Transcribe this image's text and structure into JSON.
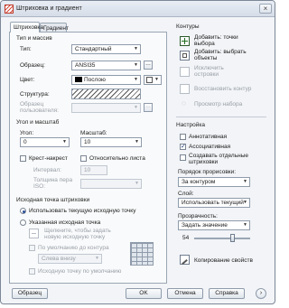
{
  "window": {
    "title": "Штриховка и градиент",
    "close_glyph": "×"
  },
  "tabs": [
    {
      "label": "Штриховка",
      "active": true
    },
    {
      "label": "Градиент",
      "active": false
    }
  ],
  "type_pattern": {
    "section": "Тип и массив",
    "type_label": "Тип:",
    "type_value": "Стандартный",
    "pattern_label": "Образец:",
    "pattern_value": "ANSI35",
    "color_label": "Цвет:",
    "color_value": "Послою",
    "structure_label": "Структура:",
    "user_pattern_label": "Образец пользователя:"
  },
  "angle_scale": {
    "section": "Угол и масштаб",
    "angle_label": "Угол:",
    "angle_value": "0",
    "scale_label": "Масштаб:",
    "scale_value": "10",
    "cross_label": "Крест-накрест",
    "relative_label": "Относительно листа",
    "interval_label": "Интервал:",
    "interval_value": "10",
    "pen_label": "Толщина пера ISO:"
  },
  "origin": {
    "section": "Исходная точка штриховки",
    "use_current_label": "Использовать текущую исходную точку",
    "specified_label": "Указанная исходная точка",
    "click_label": "Щелкните, чтобы задать новую исходную точку",
    "default_extents_label": "По умолчанию до контура",
    "extents_value": "Слева внизу",
    "store_label": "Исходную точку по умолчанию"
  },
  "contours": {
    "section": "Контуры",
    "add_pick_label": "Добавить: точки выбора",
    "add_select_label": "Добавить: выбрать объекты",
    "remove_label": "Исключить островки",
    "recreate_label": "Восстановить контур",
    "view_label": "Просмотр набора"
  },
  "options": {
    "section": "Настройка",
    "annotative_label": "Аннотативная",
    "associative_label": "Ассоциативная",
    "separate_label": "Создавать отдельные штриховки",
    "draw_order_label": "Порядок прорисовки:",
    "draw_order_value": "За контуром",
    "layer_label": "Слой:",
    "layer_value": "Использовать текущий",
    "transparency_label": "Прозрачность:",
    "transparency_value": "Задать значение",
    "transparency_number": "54",
    "inherit_label": "Копирование свойств"
  },
  "footer": {
    "preview": "Образец",
    "ok": "OK",
    "cancel": "Отмена",
    "help": "Справка"
  }
}
